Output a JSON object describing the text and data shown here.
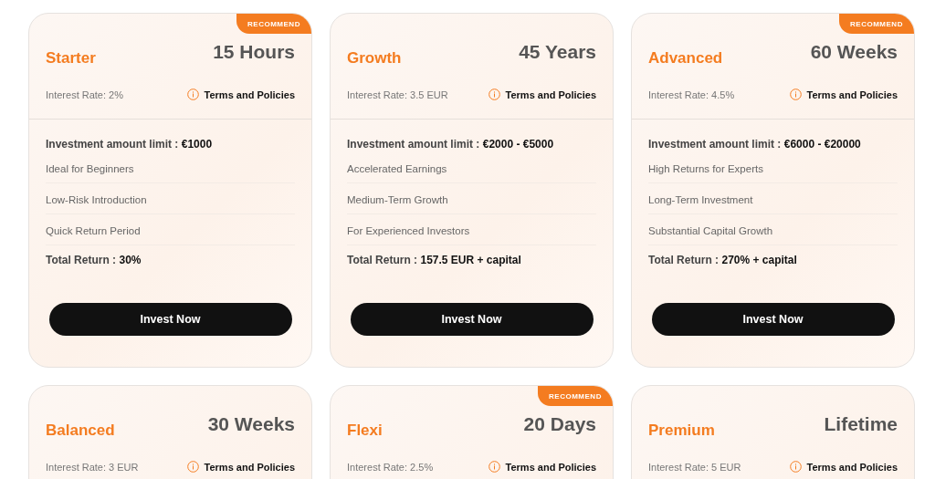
{
  "plans": [
    {
      "name": "Starter",
      "duration": "15 Hours",
      "interest": "Interest Rate: 2%",
      "terms": "Terms and Policies",
      "limit": {
        "label": "Investment amount limit :",
        "value": "€1000"
      },
      "features": [
        "Ideal for Beginners",
        "Low-Risk Introduction",
        "Quick Return Period"
      ],
      "total": {
        "label": "Total Return :",
        "value": "30%"
      },
      "button": "Invest Now",
      "badge": "RECOMMEND"
    },
    {
      "name": "Growth",
      "duration": "45 Years",
      "interest": "Interest Rate: 3.5 EUR",
      "terms": "Terms and Policies",
      "limit": {
        "label": "Investment amount limit :",
        "value": "€2000 - €5000"
      },
      "features": [
        "Accelerated Earnings",
        "Medium-Term Growth",
        "For Experienced Investors"
      ],
      "total": {
        "label": "Total Return :",
        "value": "157.5 EUR + capital"
      },
      "button": "Invest Now"
    },
    {
      "name": "Advanced",
      "duration": "60 Weeks",
      "interest": "Interest Rate: 4.5%",
      "terms": "Terms and Policies",
      "limit": {
        "label": "Investment amount limit :",
        "value": "€6000 - €20000"
      },
      "features": [
        "High Returns for Experts",
        "Long-Term Investment",
        "Substantial Capital Growth"
      ],
      "total": {
        "label": "Total Return :",
        "value": "270% + capital"
      },
      "button": "Invest Now",
      "badge": "RECOMMEND"
    },
    {
      "name": "Balanced",
      "duration": "30 Weeks",
      "interest": "Interest Rate: 3 EUR",
      "terms": "Terms and Policies"
    },
    {
      "name": "Flexi",
      "duration": "20 Days",
      "interest": "Interest Rate: 2.5%",
      "terms": "Terms and Policies",
      "badge": "RECOMMEND"
    },
    {
      "name": "Premium",
      "duration": "Lifetime",
      "interest": "Interest Rate: 5 EUR",
      "terms": "Terms and Policies"
    }
  ]
}
